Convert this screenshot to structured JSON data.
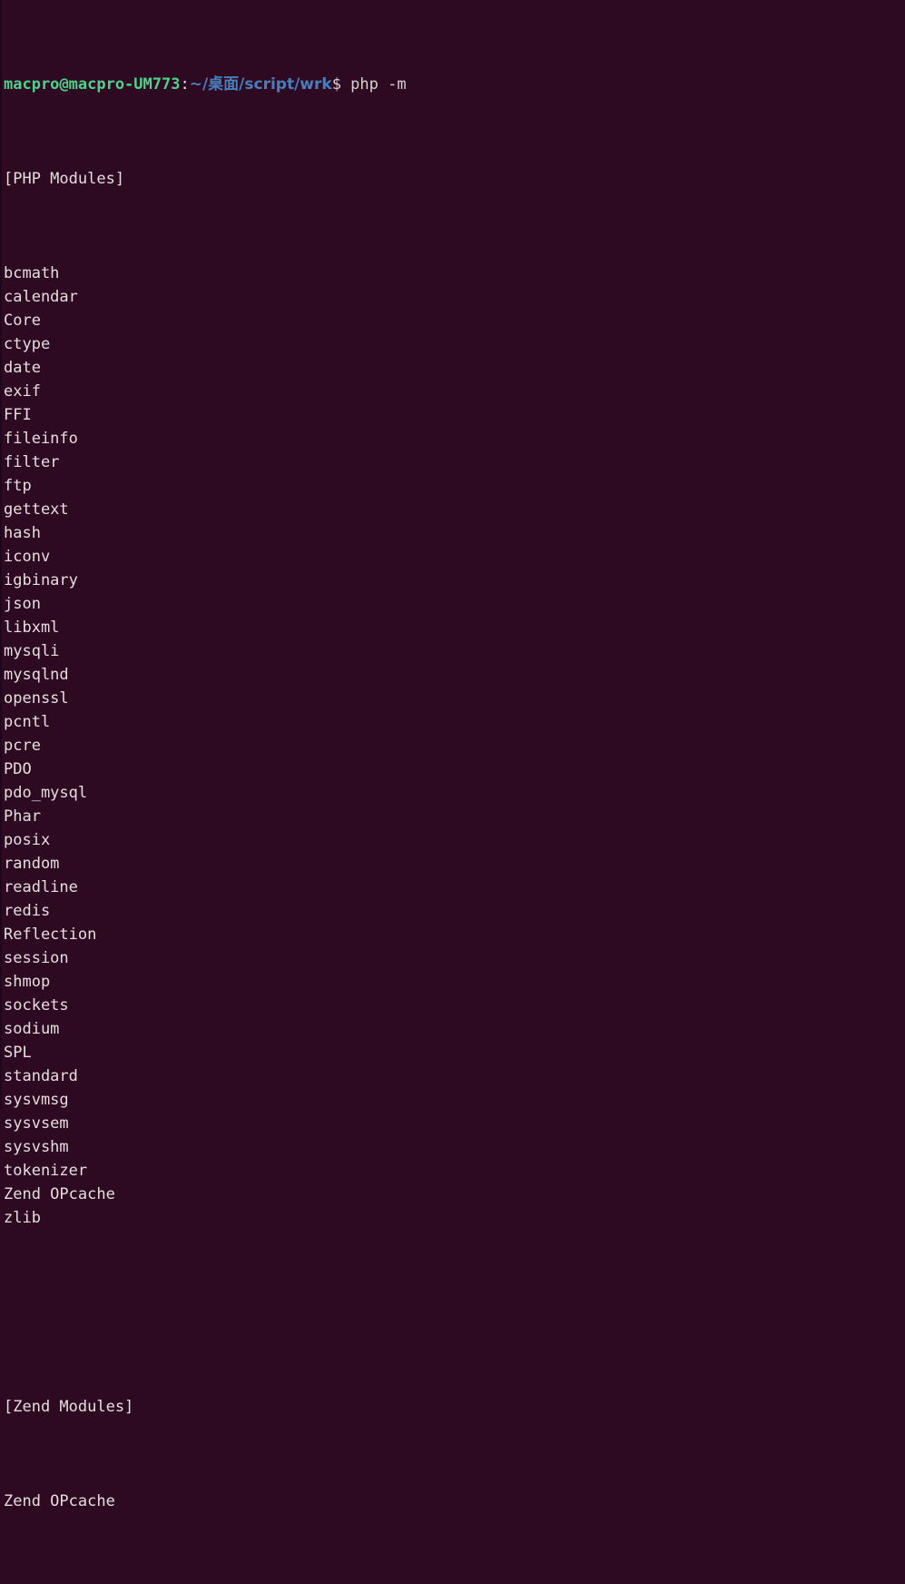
{
  "terminal": {
    "background_color": "#2d0922",
    "foreground_color": "#e8e3e3",
    "prompt": {
      "user_host": "macpro@macpro-UM773",
      "colon": ":",
      "path": "~/桌面/script/wrk",
      "dollar_and_command": "$ php -m",
      "user_host_color": "#4fd18b",
      "path_color": "#4a7ebb"
    },
    "output": {
      "php_modules_header": "[PHP Modules]",
      "php_modules": [
        "bcmath",
        "calendar",
        "Core",
        "ctype",
        "date",
        "exif",
        "FFI",
        "fileinfo",
        "filter",
        "ftp",
        "gettext",
        "hash",
        "iconv",
        "igbinary",
        "json",
        "libxml",
        "mysqli",
        "mysqlnd",
        "openssl",
        "pcntl",
        "pcre",
        "PDO",
        "pdo_mysql",
        "Phar",
        "posix",
        "random",
        "readline",
        "redis",
        "Reflection",
        "session",
        "shmop",
        "sockets",
        "sodium",
        "SPL",
        "standard",
        "sysvmsg",
        "sysvsem",
        "sysvshm",
        "tokenizer",
        "Zend OPcache",
        "zlib"
      ],
      "zend_modules_header": "[Zend Modules]",
      "zend_modules": [
        "Zend OPcache"
      ]
    }
  }
}
